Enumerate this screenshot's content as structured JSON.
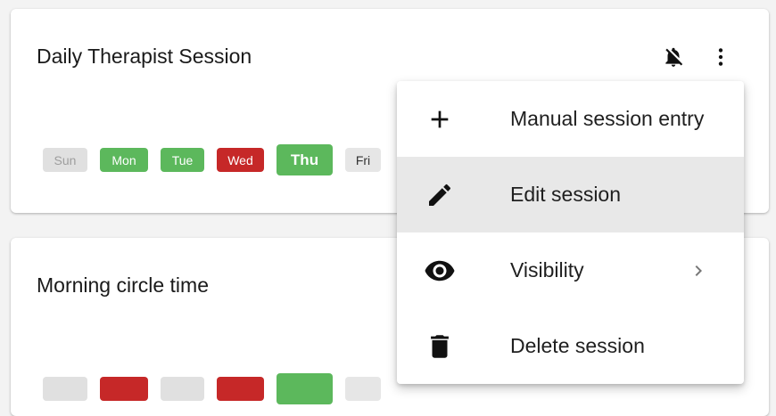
{
  "sessions": [
    {
      "title": "Daily Therapist Session",
      "days": [
        "Sun",
        "Mon",
        "Tue",
        "Wed",
        "Thu",
        "Fri"
      ]
    },
    {
      "title": "Morning circle time"
    }
  ],
  "menu": {
    "items": [
      {
        "label": "Manual session entry",
        "icon": "plus-icon"
      },
      {
        "label": "Edit session",
        "icon": "pencil-icon"
      },
      {
        "label": "Visibility",
        "icon": "eye-icon"
      },
      {
        "label": "Delete session",
        "icon": "trash-icon"
      }
    ]
  },
  "colors": {
    "completed": "#5cb85c",
    "missed": "#c62828",
    "inactive": "#e0e0e0"
  }
}
